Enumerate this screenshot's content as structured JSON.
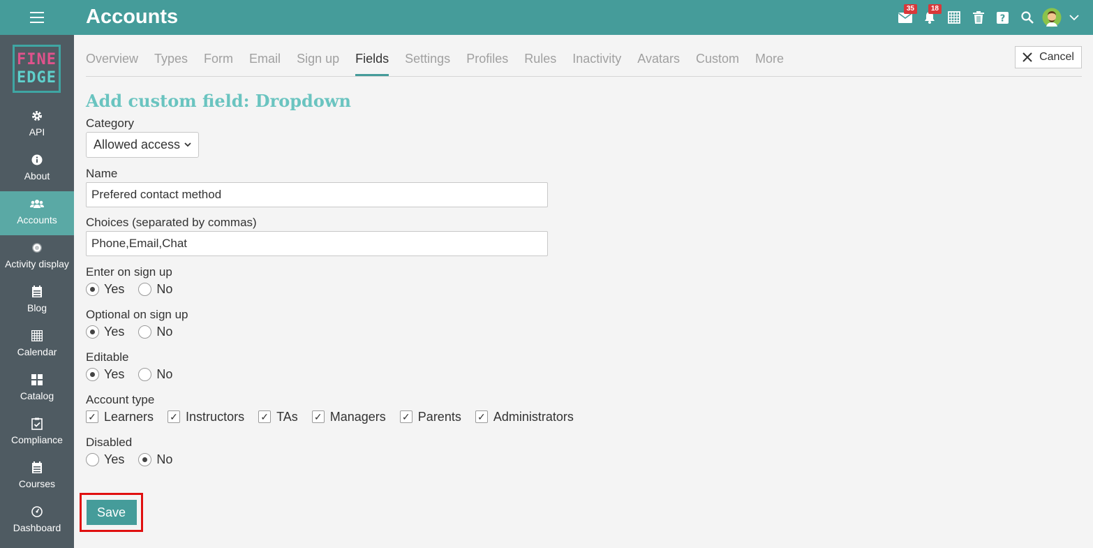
{
  "header": {
    "title": "Accounts",
    "icons": [
      {
        "name": "messages-icon",
        "badge": "35"
      },
      {
        "name": "notifications-icon",
        "badge": "18"
      },
      {
        "name": "calendar-icon"
      },
      {
        "name": "trash-icon"
      },
      {
        "name": "help-icon"
      },
      {
        "name": "search-icon"
      },
      {
        "name": "avatar"
      },
      {
        "name": "chevron-down-icon"
      }
    ]
  },
  "logo": {
    "line1": "FINE",
    "line2": "EDGE"
  },
  "sidebar": {
    "items": [
      {
        "label": "API",
        "icon": "gear-icon"
      },
      {
        "label": "About",
        "icon": "info-icon"
      },
      {
        "label": "Accounts",
        "icon": "users-icon",
        "active": true
      },
      {
        "label": "Activity display",
        "icon": "radio-dot-icon"
      },
      {
        "label": "Blog",
        "icon": "blog-icon"
      },
      {
        "label": "Calendar",
        "icon": "calendar-icon"
      },
      {
        "label": "Catalog",
        "icon": "grid-icon"
      },
      {
        "label": "Compliance",
        "icon": "clipboard-check-icon"
      },
      {
        "label": "Courses",
        "icon": "courses-icon"
      },
      {
        "label": "Dashboard",
        "icon": "dashboard-icon"
      }
    ]
  },
  "tabs": [
    "Overview",
    "Types",
    "Form",
    "Email",
    "Sign up",
    "Fields",
    "Settings",
    "Profiles",
    "Rules",
    "Inactivity",
    "Avatars",
    "Custom",
    "More"
  ],
  "active_tab": "Fields",
  "cancel_label": "Cancel",
  "page_title": "Add custom field: Dropdown",
  "form": {
    "category": {
      "label": "Category",
      "value": "Allowed access"
    },
    "name": {
      "label": "Name",
      "value": "Prefered contact method"
    },
    "choices": {
      "label": "Choices (separated by commas)",
      "value": "Phone,Email,Chat"
    },
    "enter_on_signup": {
      "label": "Enter on sign up",
      "yes": "Yes",
      "no": "No",
      "selected": "Yes"
    },
    "optional_on_signup": {
      "label": "Optional on sign up",
      "yes": "Yes",
      "no": "No",
      "selected": "Yes"
    },
    "editable": {
      "label": "Editable",
      "yes": "Yes",
      "no": "No",
      "selected": "Yes"
    },
    "account_type": {
      "label": "Account type",
      "options": [
        "Learners",
        "Instructors",
        "TAs",
        "Managers",
        "Parents",
        "Administrators"
      ]
    },
    "disabled": {
      "label": "Disabled",
      "yes": "Yes",
      "no": "No",
      "selected": "No"
    }
  },
  "save_label": "Save",
  "colors": {
    "brand": "#459c9a",
    "sidebar": "#4f5b62",
    "title_accent": "#6ac4c0",
    "highlight": "#e01010",
    "badge": "#d9383a"
  }
}
